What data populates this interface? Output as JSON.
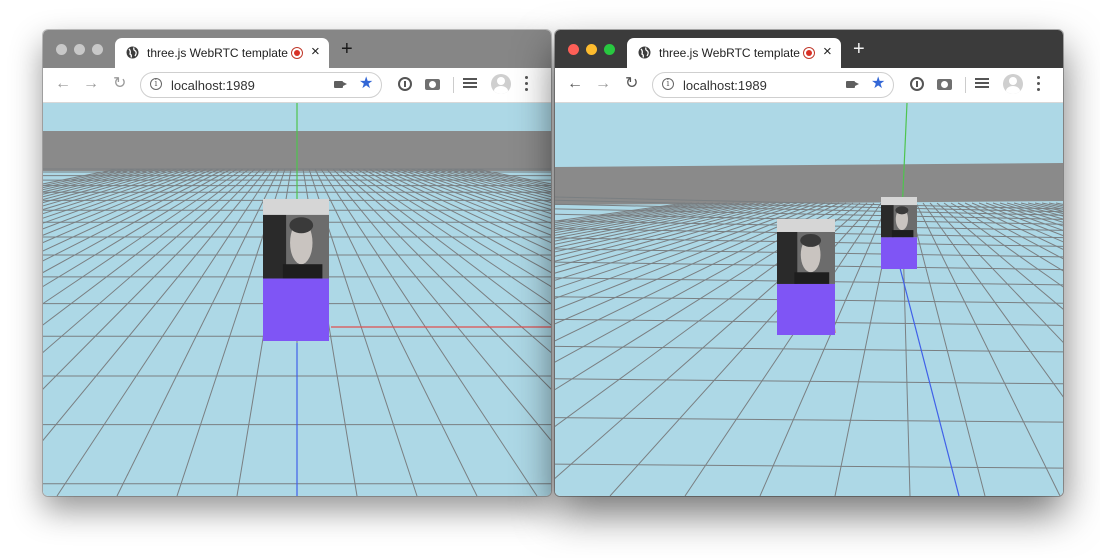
{
  "windows": [
    {
      "id": "left",
      "tab_title": "three.js WebRTC template",
      "tab_close": "×",
      "new_tab": "+",
      "url": "localhost:1989",
      "nav": {
        "back": "←",
        "forward": "→",
        "reload": "↻"
      },
      "bookmark_star": "★",
      "info_glyph": "i",
      "active": false
    },
    {
      "id": "right",
      "tab_title": "three.js WebRTC template",
      "tab_close": "×",
      "new_tab": "+",
      "url": "localhost:1989",
      "nav": {
        "back": "←",
        "forward": "→",
        "reload": "↻"
      },
      "bookmark_star": "★",
      "info_glyph": "i",
      "active": true
    }
  ],
  "colors": {
    "sky": "#add8e6",
    "horizon_wall": "#8a8a8a",
    "grid_line": "#7a7f82",
    "cube_bottom": "#7f55f5",
    "axis_x": "#e05050",
    "axis_y": "#4ec44e",
    "axis_z": "#4060e8",
    "traffic_close": "#fe5f57",
    "traffic_minimize": "#febc2e",
    "traffic_zoom": "#28c840"
  },
  "icons": [
    "globe-icon",
    "recording-icon",
    "close-icon",
    "plus-icon",
    "back-arrow-icon",
    "forward-arrow-icon",
    "reload-icon",
    "info-icon",
    "camera-icon",
    "star-icon",
    "extension-icon",
    "screenshot-icon",
    "media-controls-icon",
    "avatar-icon",
    "more-menu-icon"
  ]
}
